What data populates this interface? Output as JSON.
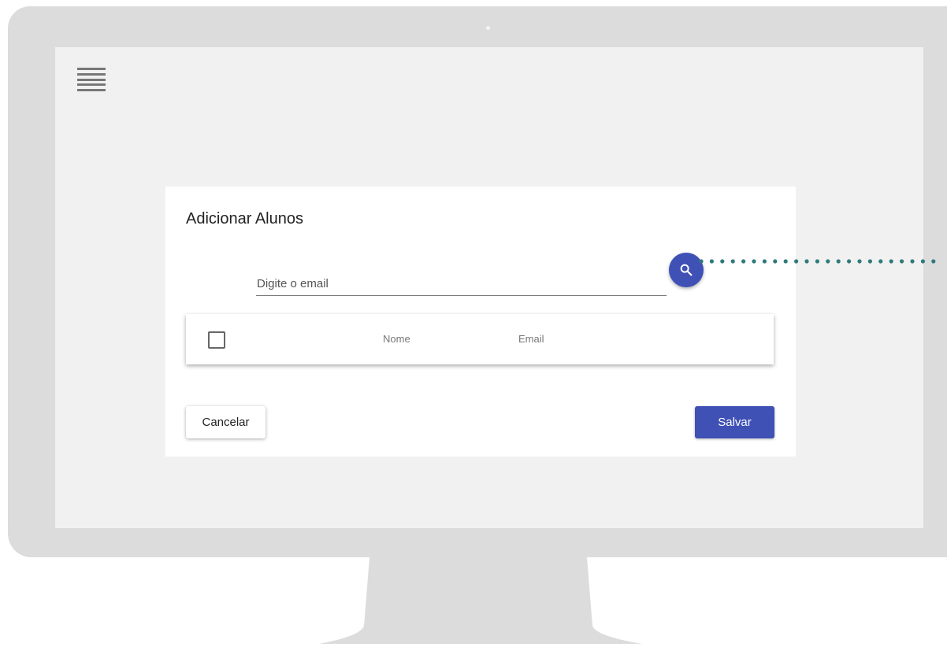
{
  "dialog": {
    "title": "Adicionar Alunos",
    "email_placeholder": "Digite o email",
    "search_icon": "search-icon",
    "table": {
      "columns": [
        "Nome",
        "Email"
      ],
      "select_all_checked": false
    },
    "buttons": {
      "cancel": "Cancelar",
      "save": "Salvar"
    }
  },
  "menu_icon": "hamburger-menu-icon",
  "colors": {
    "primary": "#3f51b5",
    "annotation_dots": "#2f7a7a",
    "screen_background": "#f1f1f1",
    "monitor_frame": "#dcdcdc"
  }
}
